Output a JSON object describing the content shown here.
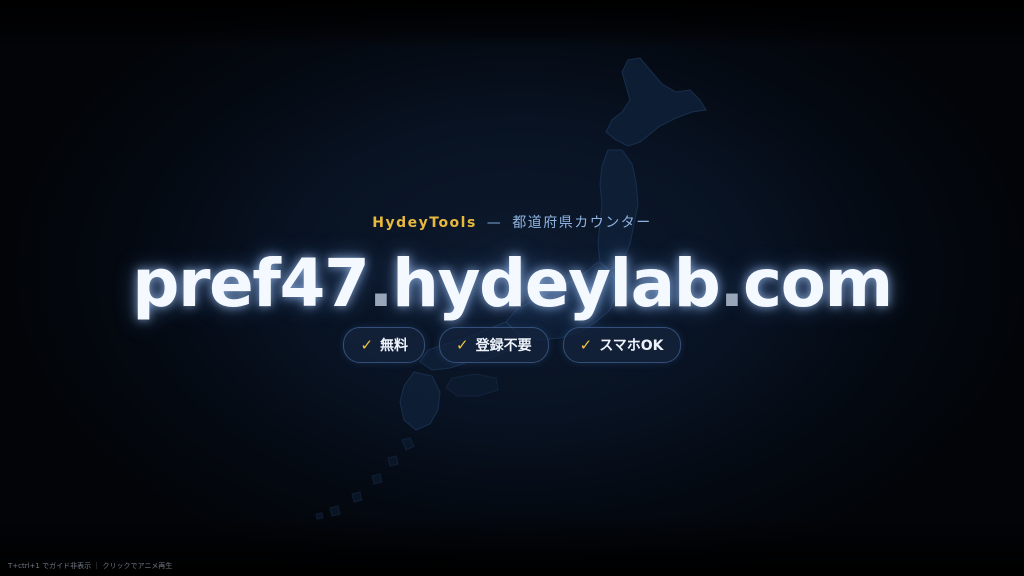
{
  "brand": {
    "name": "HydeyTools",
    "separator": "—",
    "subtitle": "都道府県カウンター"
  },
  "domain": {
    "part1": "pref47",
    "dot1": ".",
    "part2": "hydeylab",
    "dot2": ".",
    "part3": "com"
  },
  "badges": [
    {
      "check": "✓",
      "label": "無料"
    },
    {
      "check": "✓",
      "label": "登録不要"
    },
    {
      "check": "✓",
      "label": "スマホOK"
    }
  ],
  "hint": "T+ctrl+1 でガイド非表示 ｜ クリックでアニメ再生",
  "colors": {
    "accent": "#e7b93e",
    "background": "#050b16",
    "text": "#f4f8ff"
  }
}
